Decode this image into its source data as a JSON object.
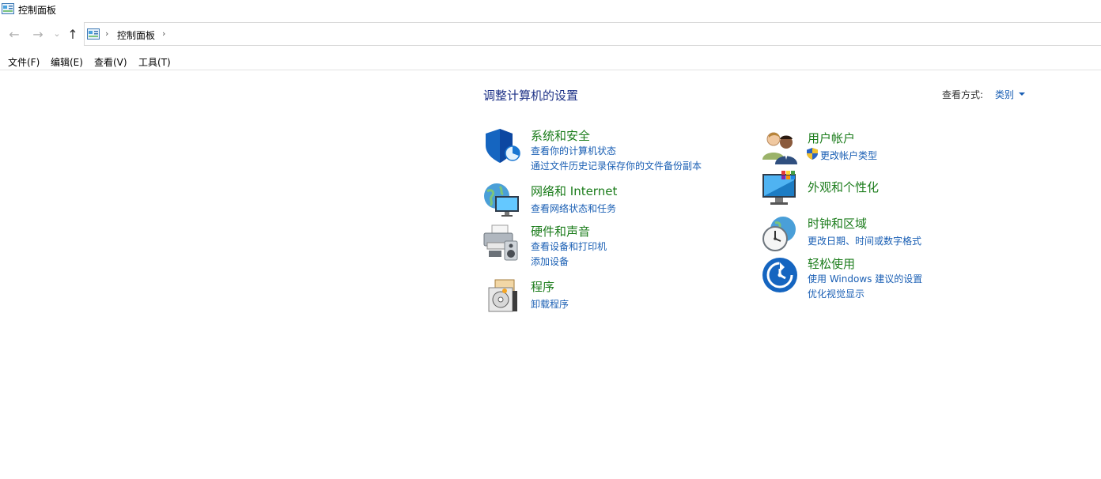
{
  "window": {
    "title": "控制面板",
    "icon": "control-panel-icon"
  },
  "nav": {
    "back_icon": "arrow-left-icon",
    "forward_icon": "arrow-right-icon",
    "recent_icon": "chevron-down-icon",
    "up_icon": "arrow-up-icon",
    "back_glyph": "←",
    "forward_glyph": "→",
    "recent_glyph": "⌄",
    "up_glyph": "↑"
  },
  "address": {
    "crumbs": [
      "控制面板"
    ],
    "separator": "›"
  },
  "menu": [
    "文件(F)",
    "编辑(E)",
    "查看(V)",
    "工具(T)"
  ],
  "main": {
    "heading": "调整计算机的设置",
    "view_by_label": "查看方式:",
    "view_by_value": "类别",
    "left_column": [
      {
        "title": "系统和安全",
        "icon": "shield-icon",
        "links": [
          "查看你的计算机状态",
          "通过文件历史记录保存你的文件备份副本"
        ]
      },
      {
        "title": "网络和 Internet",
        "icon": "globe-network-icon",
        "links": [
          "查看网络状态和任务"
        ]
      },
      {
        "title": "硬件和声音",
        "icon": "printer-speaker-icon",
        "links": [
          "查看设备和打印机",
          "添加设备"
        ]
      },
      {
        "title": "程序",
        "icon": "programs-icon",
        "links": [
          "卸载程序"
        ]
      }
    ],
    "right_column": [
      {
        "title": "用户帐户",
        "icon": "users-icon",
        "links": [
          "更改帐户类型"
        ]
      },
      {
        "title": "外观和个性化",
        "icon": "monitor-palette-icon",
        "links": []
      },
      {
        "title": "时钟和区域",
        "icon": "clock-globe-icon",
        "links": [
          "更改日期、时间或数字格式"
        ]
      },
      {
        "title": "轻松使用",
        "icon": "ease-of-access-icon",
        "links": [
          "使用 Windows 建议的设置",
          "优化视觉显示"
        ]
      }
    ]
  },
  "colors": {
    "heading": "#1e3287",
    "category_title": "#1b7c1b",
    "link": "#1a5fb4"
  }
}
